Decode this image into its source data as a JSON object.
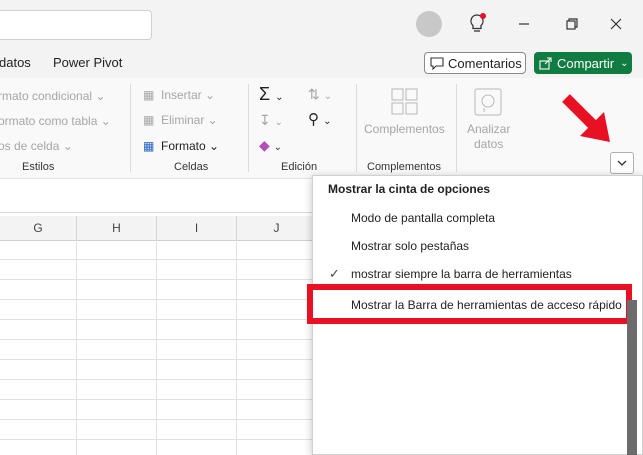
{
  "tabs": [
    "datos",
    "Power Pivot"
  ],
  "buttons": {
    "comentarios": "Comentarios",
    "compartir": "Compartir"
  },
  "ribbon": {
    "estilos": {
      "items": [
        "rmato condicional",
        "ormato como tabla",
        "os de celda"
      ],
      "label": "Estilos"
    },
    "celdas": {
      "items": [
        "Insertar",
        "Eliminar",
        "Formato"
      ],
      "label": "Celdas"
    },
    "edicion": {
      "label": "Edición"
    },
    "complementos": {
      "button": "Complementos",
      "label": "Complementos"
    },
    "analizar": {
      "line1": "Analizar",
      "line2": "datos"
    }
  },
  "columns": [
    "G",
    "H",
    "I",
    "J"
  ],
  "menu": {
    "title": "Mostrar la cinta de opciones",
    "items": [
      "Modo de pantalla completa",
      "Mostrar solo pestañas",
      "mostrar siempre la barra de herramientas",
      "Mostrar la Barra de herramientas de acceso rápido"
    ],
    "checked_index": 2
  },
  "colors": {
    "accent_green": "#107c41",
    "highlight_red": "#e81123"
  }
}
